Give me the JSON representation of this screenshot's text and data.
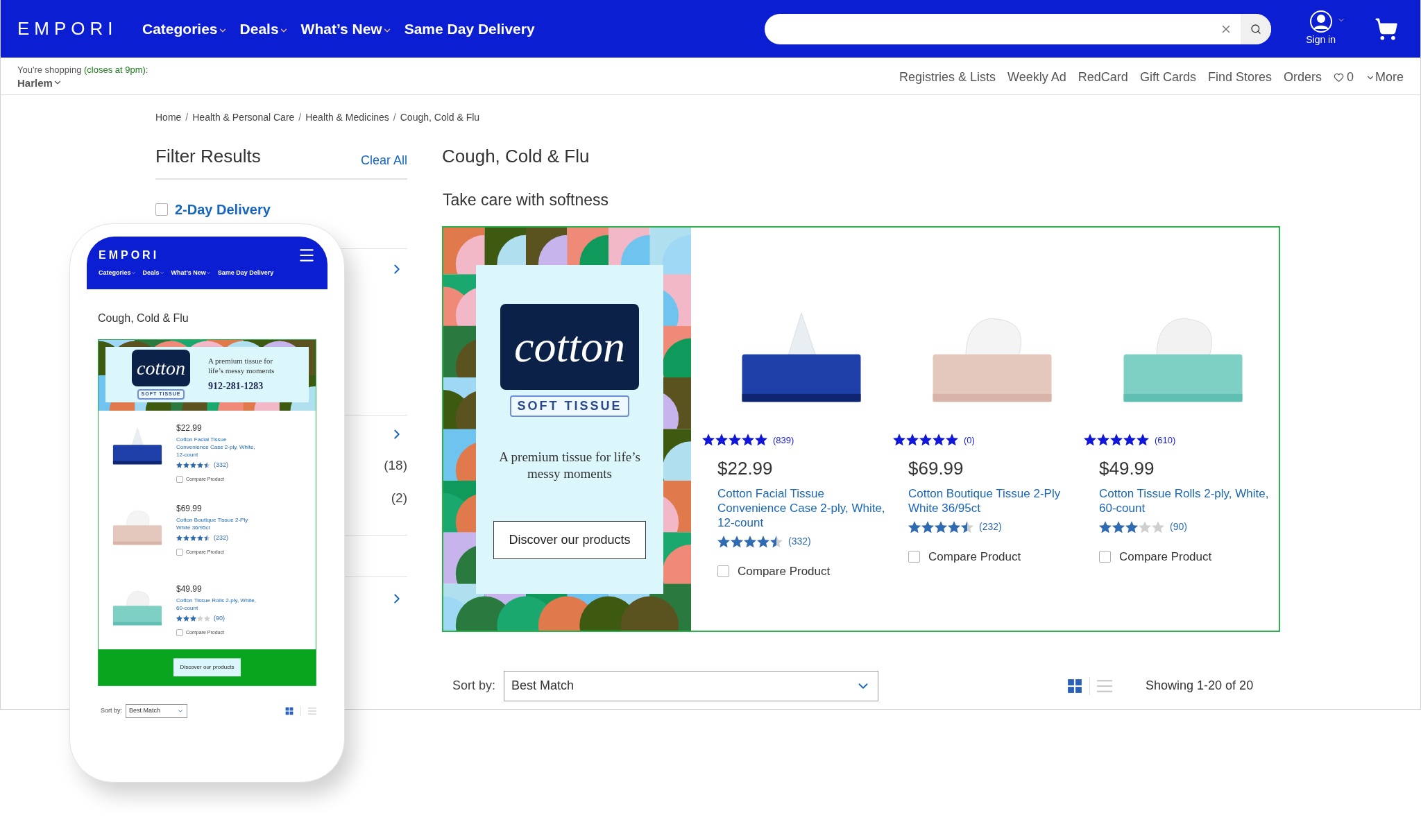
{
  "header": {
    "logo": "EMPORI",
    "nav": [
      {
        "label": "Categories",
        "has_menu": true
      },
      {
        "label": "Deals",
        "has_menu": true
      },
      {
        "label": "What’s New",
        "has_menu": true
      },
      {
        "label": "Same Day Delivery",
        "has_menu": false
      }
    ],
    "account": "Sign in"
  },
  "store_bar": {
    "shopping": "You're shopping",
    "hours": "(closes at 9pm)",
    "colon": ":",
    "store": "Harlem",
    "links": [
      "Registries & Lists",
      "Weekly Ad",
      "RedCard",
      "Gift Cards",
      "Find Stores",
      "Orders"
    ],
    "favorites": "0",
    "more": "More"
  },
  "breadcrumb": [
    {
      "label": "Home"
    },
    {
      "separator": "/",
      "label": "Health & Personal Care"
    },
    {
      "separator": "/",
      "label": "Health & Medicines"
    },
    {
      "separator": "/",
      "label": "Cough, Cold & Flu"
    }
  ],
  "filters": {
    "title": "Filter Results",
    "clear": "Clear All",
    "options": [
      {
        "label": "2-Day Delivery",
        "checked": false
      }
    ],
    "counts": [
      "(18)",
      "(2)"
    ]
  },
  "main": {
    "title": "Cough, Cold & Flu",
    "promo_title": "Take care with softness",
    "promo": {
      "brand": "cotton",
      "tagline": "SOFT TISSUE",
      "copy": "A premium tissue for life’s messy moments",
      "button": "Discover our products"
    },
    "products": [
      {
        "top_rating": {
          "stars": 5,
          "count": "(839)"
        },
        "price": "$22.99",
        "name": "Cotton Facial Tissue Convenience Case 2-ply, White, 12-count",
        "stars": 4.5,
        "count": "(332)",
        "compare": "Compare Product",
        "checked": false
      },
      {
        "top_rating": {
          "stars": 5,
          "count": "(0)"
        },
        "price": "$69.99",
        "name": "Cotton Boutique Tissue 2-Ply White 36/95ct",
        "stars": 4.5,
        "count": "(232)",
        "compare": "Compare Product",
        "checked": false
      },
      {
        "top_rating": {
          "stars": 5,
          "count": "(610)"
        },
        "price": "$49.99",
        "name": "Cotton Tissue Rolls 2-ply, White, 60-count",
        "stars": 3,
        "count": "(90)",
        "compare": "Compare Product",
        "checked": false
      }
    ]
  },
  "sort": {
    "label": "Sort by:",
    "value": "Best Match",
    "views": [
      {
        "kind": "grid",
        "selected": true
      },
      {
        "kind": "list",
        "selected": false
      }
    ],
    "showing": "Showing 1-20 of 20"
  },
  "phone": {
    "logo": "EMPORI",
    "nav": [
      {
        "label": "Categories",
        "has_menu": true
      },
      {
        "label": "Deals",
        "has_menu": true
      },
      {
        "label": "What’s New",
        "has_menu": true
      },
      {
        "label": "Same Day Delivery",
        "has_menu": false
      }
    ],
    "title": "Cough, Cold & Flu",
    "promo": {
      "brand": "cotton",
      "tagline": "SOFT TISSUE",
      "copy": "A premium tissue for life’s messy moments",
      "phone_number": "912-281-1283",
      "button": "Discover our products"
    },
    "products": [
      {
        "price": "$22.99",
        "name": "Cotton Facial Tissue Convenience Case 2-ply, White, 12-count",
        "stars": 4.5,
        "count": "(332)",
        "compare": "Compare Product",
        "checked": false
      },
      {
        "price": "$69.99",
        "name": "Cotton Boutique Tissue 2-Ply White 36/95ct",
        "stars": 4.5,
        "count": "(232)",
        "compare": "Compare Product",
        "checked": false
      },
      {
        "price": "$49.99",
        "name": "Cotton Tissue Rolls 2-ply, White, 60-count",
        "stars": 3,
        "count": "(90)",
        "compare": "Compare Product",
        "checked": false
      }
    ],
    "sort": {
      "label": "Sort by:",
      "value": "Best Match",
      "views": [
        {
          "kind": "grid",
          "selected": true
        },
        {
          "kind": "list",
          "selected": false
        }
      ]
    }
  }
}
